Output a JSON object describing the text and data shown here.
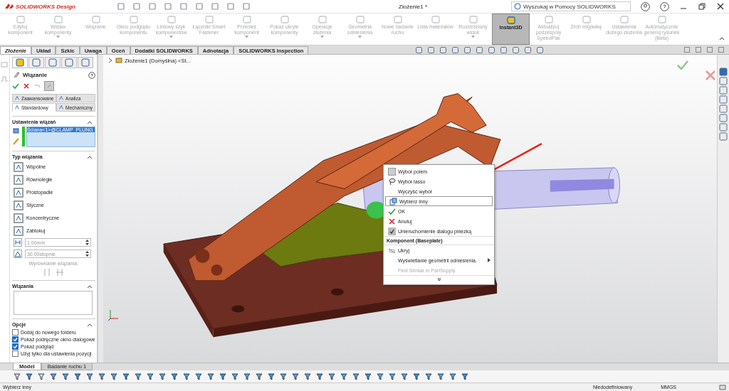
{
  "app": {
    "logo": "SOLIDWORKS Design",
    "title": "Złożenie1 *",
    "search_placeholder": "Wyszukaj w Pomocy SOLIDWORKS"
  },
  "ribbon": [
    {
      "label": "Edytuj komponent",
      "disabled": true,
      "selected": false,
      "dropdown": false
    },
    {
      "label": "Wstaw komponenty",
      "disabled": true,
      "selected": false,
      "dropdown": true
    },
    {
      "label": "Wiązanie",
      "disabled": true,
      "selected": false,
      "dropdown": false
    },
    {
      "label": "Okno podglądu komponentu",
      "disabled": true,
      "selected": false,
      "dropdown": false
    },
    {
      "label": "Liniowy szyk komponentów",
      "disabled": true,
      "selected": false,
      "dropdown": true
    },
    {
      "label": "Łączniki Smart Fastener",
      "disabled": true,
      "selected": false,
      "dropdown": false
    },
    {
      "label": "Przenieś komponent",
      "disabled": true,
      "selected": false,
      "dropdown": true
    },
    {
      "label": "Pokaż ukryte komponenty",
      "disabled": true,
      "selected": false,
      "dropdown": false
    },
    {
      "label": "Operacje złożenia",
      "disabled": true,
      "selected": false,
      "dropdown": true
    },
    {
      "label": "Geometria odniesienia",
      "disabled": true,
      "selected": false,
      "dropdown": true
    },
    {
      "label": "Nowe badanie ruchu",
      "disabled": true,
      "selected": false,
      "dropdown": false
    },
    {
      "label": "Lista materiałów",
      "disabled": true,
      "selected": false,
      "dropdown": false
    },
    {
      "label": "Rozstrzelony widok",
      "disabled": true,
      "selected": false,
      "dropdown": true
    },
    {
      "label": "Instant3D",
      "disabled": false,
      "selected": true,
      "dropdown": false
    },
    {
      "label": "Aktualizuj podzespoły SpeedPak",
      "disabled": true,
      "selected": false,
      "dropdown": false
    },
    {
      "label": "Zrób migawkę",
      "disabled": true,
      "selected": false,
      "dropdown": false
    },
    {
      "label": "Ustawienia dużego złożenia",
      "disabled": true,
      "selected": false,
      "dropdown": false
    },
    {
      "label": "Automatycznie generuj rysunek (Beta)",
      "disabled": true,
      "selected": false,
      "dropdown": false
    }
  ],
  "command_tabs": [
    {
      "label": "Złożenie",
      "selected": true
    },
    {
      "label": "Układ",
      "selected": false
    },
    {
      "label": "Szkic",
      "selected": false
    },
    {
      "label": "Uwaga",
      "selected": false
    },
    {
      "label": "Oceń",
      "selected": false
    },
    {
      "label": "Dodatki SOLIDWORKS",
      "selected": false
    },
    {
      "label": "Adnotacja",
      "selected": false
    },
    {
      "label": "SOLIDWORKS Inspection",
      "selected": false
    }
  ],
  "tree_path": "Złożenie1 (Domyślna) <St...",
  "property_manager": {
    "title": "Wiązanie",
    "subtabs": [
      {
        "label": "Zaawansowane",
        "selected": false
      },
      {
        "label": "Analiza",
        "selected": false
      },
      {
        "label": "Standardowy",
        "selected": true
      },
      {
        "label": "Mechaniczny",
        "selected": false
      }
    ],
    "settings": {
      "title": "Ustawienia wiązań",
      "selection": "Ściana<1>@CLAMP_PLUNG"
    },
    "mate_type": {
      "title": "Typ wiązania",
      "types": [
        "Wspólne",
        "Równoległe",
        "Prostopadłe",
        "Styczne",
        "Koncentryczne",
        "Zablokuj"
      ],
      "distance": "1.00mm",
      "angle": "30.00stopnie",
      "alignment": "Wyrównanie wiązania:"
    },
    "mates": {
      "title": "Wiązania"
    },
    "options": {
      "title": "Opcje",
      "items": [
        {
          "label": "Dodaj do nowego folderu",
          "checked": false
        },
        {
          "label": "Pokaż podręczne okno dialogowe",
          "checked": true
        },
        {
          "label": "Pokaż podgląd",
          "checked": true
        },
        {
          "label": "Użyj tylko dla ustawienia pozycji",
          "checked": false
        }
      ]
    }
  },
  "context_menu": [
    {
      "kind": "item",
      "label": "Wybór polem",
      "selected": false
    },
    {
      "kind": "item",
      "label": "Wybór lasso",
      "selected": false
    },
    {
      "kind": "item",
      "label": "Wyczyść wybór",
      "selected": false
    },
    {
      "kind": "item",
      "label": "Wybierz inny",
      "selected": true
    },
    {
      "kind": "item",
      "label": "OK",
      "selected": false
    },
    {
      "kind": "item",
      "label": "Anuluj",
      "selected": false
    },
    {
      "kind": "item",
      "label": "Unieruchomienie dialogu pinezką",
      "selected": false
    },
    {
      "kind": "header",
      "label": "Komponent (Baseplate)"
    },
    {
      "kind": "item",
      "label": "Ukryj",
      "selected": false
    },
    {
      "kind": "submenu",
      "label": "Wyświetlanie geometrii odniesienia.",
      "selected": false
    },
    {
      "kind": "disabled",
      "label": "Find Similar in PartSupply",
      "selected": false
    },
    {
      "kind": "more"
    }
  ],
  "bottom_tabs": [
    {
      "label": "Model",
      "selected": true
    },
    {
      "label": "Badanie ruchu 1",
      "selected": false
    }
  ],
  "status_bar": {
    "message": "Wybierz inny",
    "state": "Niedodefiniowany",
    "units": "MMGS"
  }
}
